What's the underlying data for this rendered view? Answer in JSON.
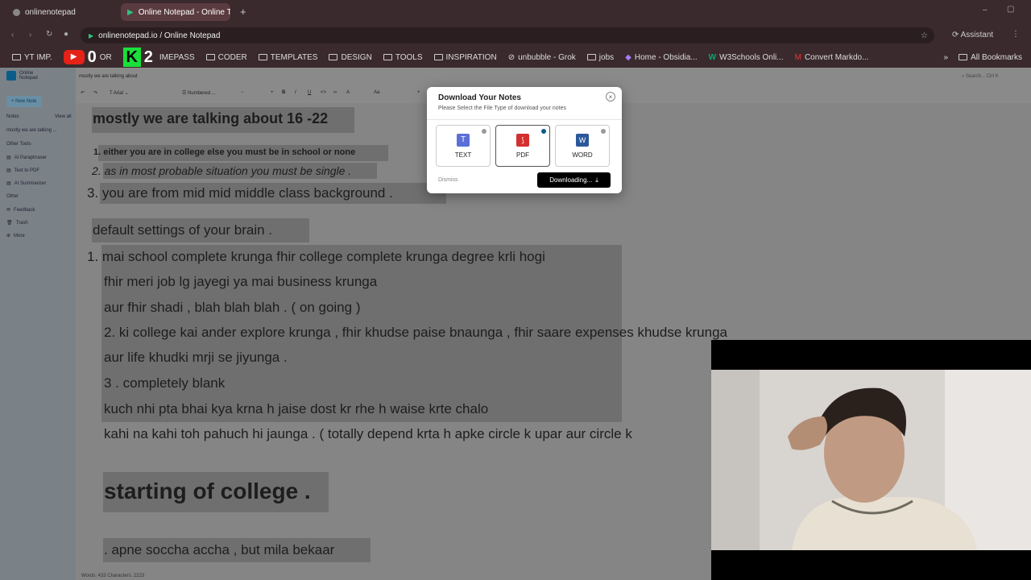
{
  "tabs": [
    {
      "title": "onlinenotepad",
      "active": false
    },
    {
      "title": "Online Notepad - Online T",
      "active": true
    }
  ],
  "address": {
    "url": "onlinenotepad.io / Online Notepad",
    "assistant": "Assistant"
  },
  "bookmarks": {
    "items": [
      "YT IMP.",
      "OR",
      "CODER",
      "TEMPLATES",
      "DESIGN",
      "TOOLS",
      "INSPIRATION",
      "unbubble - Grok",
      "jobs",
      "Home - Obsidia...",
      "W3Schools Onli...",
      "Convert Markdo..."
    ],
    "all": "All Bookmarks"
  },
  "sidebar": {
    "logo": "Online Notepad",
    "new_note": "+ New Note",
    "notes_header": "Notes",
    "view_all": "View all",
    "note_item": "mostly we are talking ...",
    "other_tools": "Other Tools",
    "tools": [
      "AI Paraphraser",
      "Text to PDF",
      "AI Summarizer"
    ],
    "other": "Other",
    "others": [
      "Feedback",
      "Trash",
      "More"
    ]
  },
  "editor": {
    "doc_title": "mostly we are talking about",
    "search_placeholder": "Search...",
    "search_shortcut": "Ctrl K",
    "font": "Arial",
    "list_style": "Numbered ...",
    "heading": "mostly we are talking about 16 -22",
    "list1": [
      "1. either you are in college else you must be in school or none",
      "2. as in most probable situation you must be single .",
      "3. you are from  mid mid middle class background ."
    ],
    "default_line": "default settings of your brain .",
    "body_lines": [
      "1. mai school complete krunga fhir college complete krunga degree krli hogi",
      "fhir meri job lg jayegi ya mai business krunga",
      "aur fhir shadi , blah blah blah . ( on going )",
      "2. ki college kai ander explore krunga , fhir khudse paise bnaunga , fhir saare expenses khudse krunga",
      "aur life khudki mrji se jiyunga .",
      "3 . completely blank",
      "kuch nhi pta bhai kya krna h jaise dost kr rhe h waise krte chalo",
      "kahi na kahi toh pahuch hi jaunga . ( totally depend krta h apke circle k upar aur circle k"
    ],
    "big_heading": "starting of college .",
    "last_line": ". apne soccha accha , but mila bekaar",
    "status": "Words: 433  Characters: 2223"
  },
  "modal": {
    "title": "Download Your Notes",
    "subtitle": "Please Select the File Type of download your notes",
    "options": [
      {
        "label": "TEXT",
        "selected": false
      },
      {
        "label": "PDF",
        "selected": true
      },
      {
        "label": "WORD",
        "selected": false
      }
    ],
    "dismiss": "Dismiss",
    "download": "Downloading..."
  },
  "overlay": {
    "text": "2"
  },
  "colors": {
    "accent": "#0a5c8a",
    "pdf": "#d32f2f",
    "word": "#2b579a",
    "text": "#5b6fd6",
    "highlight": "#6f6f6f"
  }
}
